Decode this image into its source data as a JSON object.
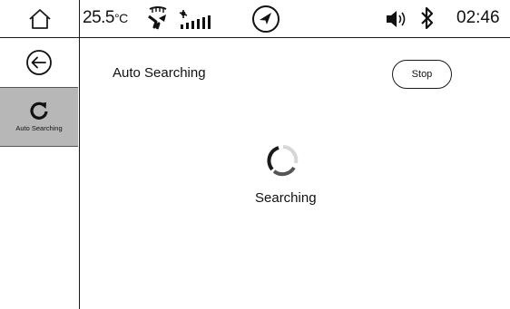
{
  "status_bar": {
    "temperature": "25.5",
    "temperature_unit": "°C",
    "time": "02:46",
    "icons": [
      "home-icon",
      "defrost-icon",
      "fan-icon",
      "navigation-icon",
      "volume-icon",
      "bluetooth-icon"
    ]
  },
  "sidebar": {
    "back_icon": "back-arrow-icon",
    "items": [
      {
        "label": "Auto Searching",
        "icon": "refresh-icon",
        "selected": true
      }
    ]
  },
  "main": {
    "title": "Auto Searching",
    "stop_label": "Stop",
    "status_text": "Searching",
    "status_icon": "loading-spinner-icon"
  },
  "colors": {
    "line": "#1a1a1a",
    "selected_tab_bg": "#b7b7b7",
    "background": "#ffffff"
  }
}
